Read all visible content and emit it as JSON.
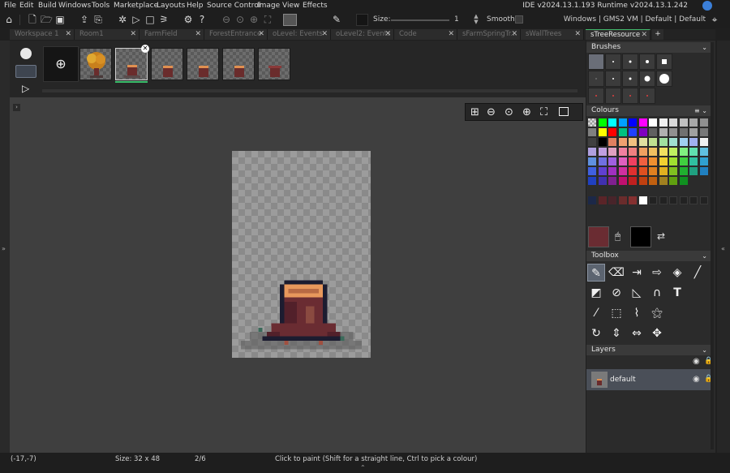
{
  "menu": {
    "items": [
      "File",
      "Edit",
      "Build",
      "Windows",
      "Tools",
      "Marketplace",
      "Layouts",
      "Help",
      "Source Control",
      "Image",
      "View",
      "Effects"
    ],
    "ide_info": "IDE v2024.13.1.193  Runtime v2024.13.1.242"
  },
  "toolbar": {
    "size_label": "Size:",
    "size_value": "1",
    "smooth_label": "Smooth",
    "target_info": "Windows | GMS2 VM | Default | Default"
  },
  "tabs": [
    {
      "label": "Workspace 1"
    },
    {
      "label": "Room1"
    },
    {
      "label": "FarmField"
    },
    {
      "label": "ForestEntrance"
    },
    {
      "label": "oLevel: Events"
    },
    {
      "label": "oLevel2: Events"
    },
    {
      "label": "Code"
    },
    {
      "label": "sFarmSpringTr..."
    },
    {
      "label": "sWallTrees"
    },
    {
      "label": "sTreeResource"
    }
  ],
  "panels": {
    "brushes": "Brushes",
    "colours": "Colours",
    "toolbox": "Toolbox",
    "layers": "Layers"
  },
  "layers": [
    {
      "name": "default"
    }
  ],
  "colours": {
    "palette_rows": [
      [
        "checker",
        "#00ff00",
        "#00ffff",
        "#00a0ff",
        "#0000ff",
        "#ff00ff",
        "#ffffff",
        "#f0f0f0",
        "#d8d8d8",
        "#c0c0c0",
        "#a8a8a8",
        "#909090"
      ],
      [
        "#808080",
        "#ffff00",
        "#ff0000",
        "#00c080",
        "#2040ff",
        "#8000c0",
        "#606060",
        "#b0b0b0",
        "#909090",
        "#707070",
        "#a0a0a0",
        "#787878"
      ],
      [
        "#404040",
        "#000000",
        "#e08060",
        "#f0a070",
        "#f0c080",
        "#e0e0a0",
        "#c0e090",
        "#a0e0a0",
        "#a0e0d0",
        "#a0d0f0",
        "#a0b0f0",
        "#f0f0f0"
      ],
      [
        "#b0a0e0",
        "#c0a0e0",
        "#e0a0c0",
        "#f080a0",
        "#f08080",
        "#f0a060",
        "#f0c060",
        "#f0e060",
        "#c0f060",
        "#80f080",
        "#60e0b0",
        "#60c0e0"
      ],
      [
        "#6090e0",
        "#7070e0",
        "#a060e0",
        "#e060c0",
        "#f04060",
        "#f06040",
        "#f09030",
        "#f0d030",
        "#a0e030",
        "#40d040",
        "#30c0a0",
        "#30a0d0"
      ],
      [
        "#4060e0",
        "#6040d0",
        "#a030c0",
        "#d030a0",
        "#e03030",
        "#e05020",
        "#e08020",
        "#e0b020",
        "#80c020",
        "#20b030",
        "#20a080",
        "#2080c0"
      ],
      [
        "#2040c0",
        "#4030b0",
        "#802090",
        "#c01070",
        "#c02020",
        "#c04010",
        "#c06010",
        "#a08020",
        "#60a010",
        "#109020"
      ],
      [
        "#1c2848",
        "#5a2428",
        "#48242a",
        "#6a2c2c",
        "#843030",
        "#ffffff"
      ]
    ],
    "primary": "#6a2c32",
    "secondary": "#000000"
  },
  "canvas": {
    "transparent_a": "#8a8a8a",
    "transparent_b": "#9c9c9c"
  },
  "status": {
    "coords": "(-17,-7)",
    "size": "Size: 32 x 48",
    "frame": "2/6",
    "hint": "Click to paint (Shift for a straight line, Ctrl to pick a colour)"
  }
}
